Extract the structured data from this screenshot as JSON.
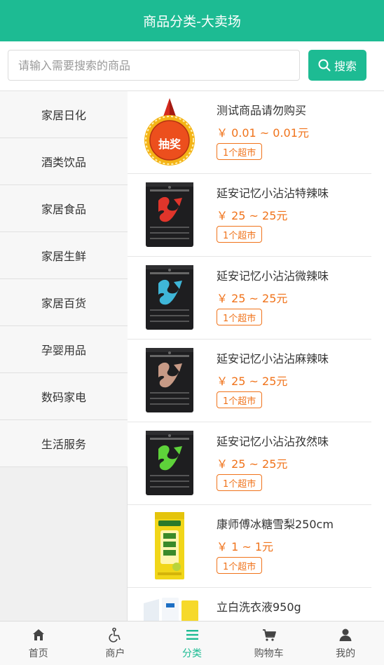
{
  "header": {
    "title": "商品分类-大卖场"
  },
  "search": {
    "placeholder": "请输入需要搜索的商品",
    "button_label": "搜索"
  },
  "sidebar": {
    "items": [
      {
        "label": "家居日化"
      },
      {
        "label": "酒类饮品"
      },
      {
        "label": "家居食品"
      },
      {
        "label": "家居生鲜"
      },
      {
        "label": "家居百货"
      },
      {
        "label": "孕婴用品"
      },
      {
        "label": "数码家电"
      },
      {
        "label": "生活服务"
      }
    ]
  },
  "products": [
    {
      "name": "测试商品请勿购买",
      "price": "￥ 0.01 ~ 0.01元",
      "tag": "1个超市",
      "badge_text": "抽奖",
      "image": "lottery-badge"
    },
    {
      "name": "延安记忆小沾沾特辣味",
      "price": "￥ 25 ~ 25元",
      "tag": "1个超市",
      "image": "snack-bag",
      "accent": "#e0352b"
    },
    {
      "name": "延安记忆小沾沾微辣味",
      "price": "￥ 25 ~ 25元",
      "tag": "1个超市",
      "image": "snack-bag",
      "accent": "#3fb6d8"
    },
    {
      "name": "延安记忆小沾沾麻辣味",
      "price": "￥ 25 ~ 25元",
      "tag": "1个超市",
      "image": "snack-bag",
      "accent": "#c79a86"
    },
    {
      "name": "延安记忆小沾沾孜然味",
      "price": "￥ 25 ~ 25元",
      "tag": "1个超市",
      "image": "snack-bag",
      "accent": "#5ed23a"
    },
    {
      "name": "康师傅冰糖雪梨250cm",
      "price": "￥ 1 ~ 1元",
      "tag": "1个超市",
      "image": "drink-pack",
      "accent": "#f1d619"
    },
    {
      "name": "立白洗衣液950g",
      "price": "",
      "tag": "",
      "image": "detergent"
    }
  ],
  "tabbar": {
    "items": [
      {
        "label": "首页",
        "icon": "home-icon"
      },
      {
        "label": "商户",
        "icon": "wheelchair-icon"
      },
      {
        "label": "分类",
        "icon": "list-icon"
      },
      {
        "label": "购物车",
        "icon": "cart-icon"
      },
      {
        "label": "我的",
        "icon": "user-icon"
      }
    ],
    "active": "分类"
  },
  "colors": {
    "brand": "#1dbb93",
    "price": "#f0731b"
  }
}
